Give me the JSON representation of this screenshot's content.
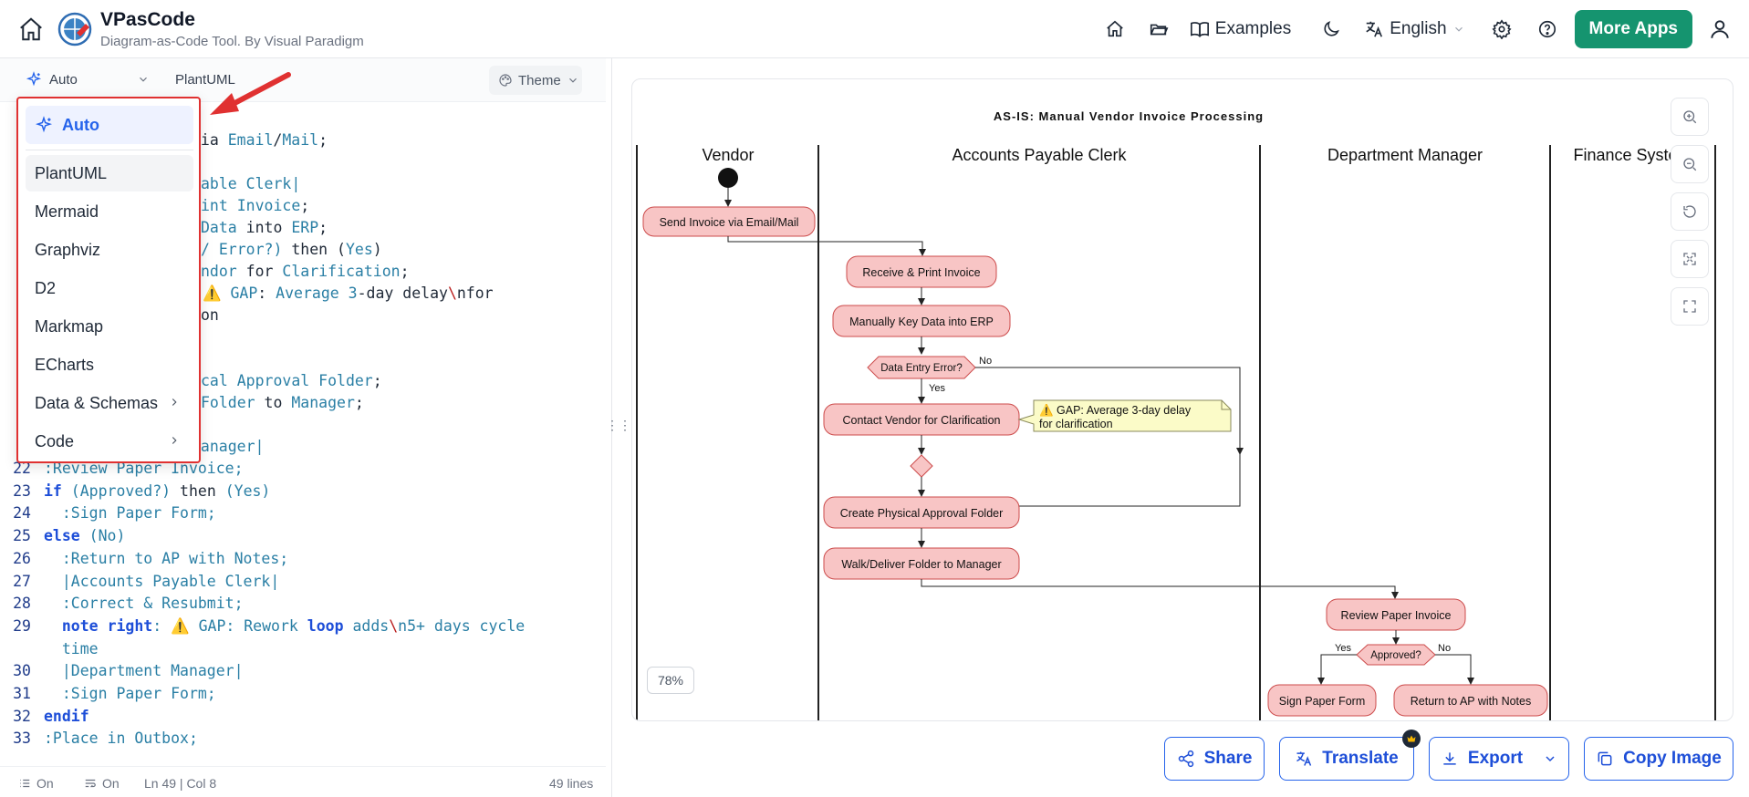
{
  "header": {
    "title": "VPasCode",
    "subtitle": "Diagram-as-Code Tool. By Visual Paradigm",
    "examples_label": "Examples",
    "language_label": "English",
    "more_apps_label": "More Apps"
  },
  "toolbar": {
    "mode_label": "Auto",
    "language_label": "PlantUML",
    "theme_label": "Theme"
  },
  "dropdown": {
    "auto_label": "Auto",
    "items": [
      "PlantUML",
      "Mermaid",
      "Graphviz",
      "D2",
      "Markmap",
      "ECharts",
      "Data & Schemas",
      "Code"
    ]
  },
  "code_fragments": {
    "l1a": "via ",
    "l1b": "Email",
    "l1c": "/",
    "l1d": "Mail",
    "l1e": ";",
    "l3": "able Clerk|",
    "l4a": "int Invoice",
    "l4b": ";",
    "l5a": "Data",
    "l5b": " into ",
    "l5c": "ERP",
    "l5d": ";",
    "l6a": "/ Error?) ",
    "l6b": "then",
    "l6c": " (",
    "l6d": "Yes",
    "l6e": ")",
    "l7a": "ndor",
    "l7b": " for ",
    "l7c": "Clarification",
    "l7d": ";",
    "l8a": "⚠️ ",
    "l8b": "GAP",
    "l8c": ": ",
    "l8d": "Average",
    "l8e": " 3",
    "l8f": "-day delay",
    "l8g": "\\",
    "l8h": "nfor",
    "l9": "on",
    "l12a": "cal Approval Folder",
    "l12b": ";",
    "l13a": "Folder",
    "l13b": " to ",
    "l13c": "Manager",
    "l13d": ";",
    "l15": "Manager|"
  },
  "code_lines": [
    {
      "n": "22",
      "text": ":Review Paper Invoice;"
    },
    {
      "n": "23",
      "text": "if (Approved?) then (Yes)"
    },
    {
      "n": "24",
      "text": "  :Sign Paper Form;"
    },
    {
      "n": "25",
      "text": "else (No)"
    },
    {
      "n": "26",
      "text": "  :Return to AP with Notes;"
    },
    {
      "n": "27",
      "text": "  |Accounts Payable Clerk|"
    },
    {
      "n": "28",
      "text": "  :Correct & Resubmit;"
    },
    {
      "n": "29",
      "text": "  note right: ⚠️ GAP: Rework loop adds\\n5+ days cycle"
    },
    {
      "n": "",
      "text": "  time"
    },
    {
      "n": "30",
      "text": "  |Department Manager|"
    },
    {
      "n": "31",
      "text": "  :Sign Paper Form;"
    },
    {
      "n": "32",
      "text": "endif"
    },
    {
      "n": "33",
      "text": ":Place in Outbox;"
    }
  ],
  "status": {
    "wrap_on": "On",
    "format_on": "On",
    "position": "Ln 49 | Col 8",
    "line_count": "49 lines"
  },
  "diagram": {
    "title": "AS-IS: Manual Vendor Invoice Processing",
    "lanes": [
      "Vendor",
      "Accounts Payable Clerk",
      "Department Manager",
      "Finance System"
    ],
    "nodes": {
      "send": "Send Invoice via Email/Mail",
      "receive": "Receive & Print Invoice",
      "key": "Manually Key Data into ERP",
      "error_q": "Data Entry Error?",
      "contact": "Contact Vendor for Clarification",
      "create": "Create Physical Approval Folder",
      "walk": "Walk/Deliver Folder to Manager",
      "review": "Review Paper Invoice",
      "approved_q": "Approved?",
      "sign": "Sign Paper Form",
      "return": "Return to AP with Notes"
    },
    "note_line1": "⚠️ GAP: Average 3-day delay",
    "note_line2": "for clarification",
    "labels": {
      "no": "No",
      "yes": "Yes"
    },
    "zoom": "78%"
  },
  "actions": {
    "share": "Share",
    "translate": "Translate",
    "export": "Export",
    "copy": "Copy Image"
  },
  "colors": {
    "accent": "#15946f",
    "action_blue": "#2563eb",
    "node_fill": "#f8c5c5",
    "node_stroke": "#cc4b4b",
    "note_fill": "#fbfbc8",
    "highlight_red": "#e03131"
  }
}
